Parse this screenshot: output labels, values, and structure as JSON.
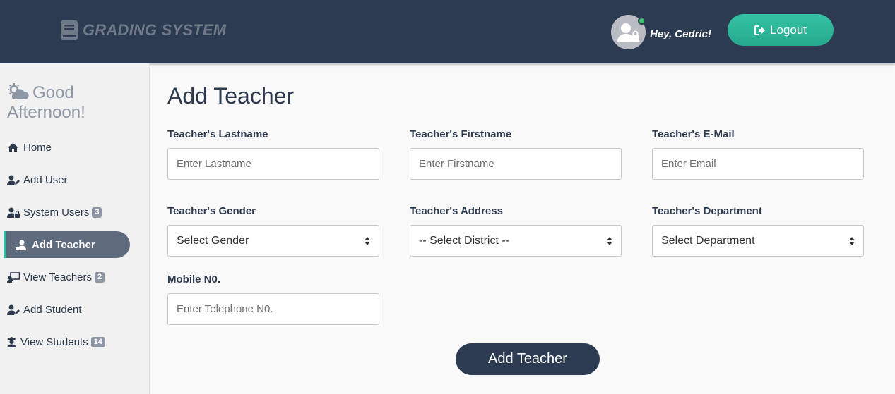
{
  "header": {
    "brand_bold": "GRADING",
    "brand_rest": " SYSTEM",
    "greeting": "Hey, Cedric!",
    "logout_label": "Logout",
    "brand_color": "#2c3b52",
    "accent_color": "#2fb99b"
  },
  "sidebar": {
    "greeting_line1": "Good",
    "greeting_line2": "Afternoon!",
    "items": [
      {
        "label": "Home",
        "icon": "home-icon",
        "badge": ""
      },
      {
        "label": "Add User",
        "icon": "user-edit-icon",
        "badge": ""
      },
      {
        "label": "System Users",
        "icon": "users-lock-icon",
        "badge": "3"
      },
      {
        "label": "Add Teacher",
        "icon": "teacher-add-icon",
        "badge": "",
        "active": true
      },
      {
        "label": "View Teachers",
        "icon": "chalkboard-teacher-icon",
        "badge": "2"
      },
      {
        "label": "Add Student",
        "icon": "user-edit-icon",
        "badge": ""
      },
      {
        "label": "View Students",
        "icon": "graduate-icon",
        "badge": "14"
      }
    ]
  },
  "main": {
    "title": "Add Teacher",
    "fields": {
      "lastname": {
        "label": "Teacher's Lastname",
        "placeholder": "Enter Lastname"
      },
      "firstname": {
        "label": "Teacher's Firstname",
        "placeholder": "Enter Firstname"
      },
      "email": {
        "label": "Teacher's E-Mail",
        "placeholder": "Enter Email"
      },
      "gender": {
        "label": "Teacher's Gender",
        "selected": "Select Gender"
      },
      "address": {
        "label": "Teacher's Address",
        "selected": "-- Select District --"
      },
      "department": {
        "label": "Teacher's Department",
        "selected": "Select Department"
      },
      "mobile": {
        "label": "Mobile N0.",
        "placeholder": "Enter Telephone N0."
      }
    },
    "submit_label": "Add Teacher"
  }
}
